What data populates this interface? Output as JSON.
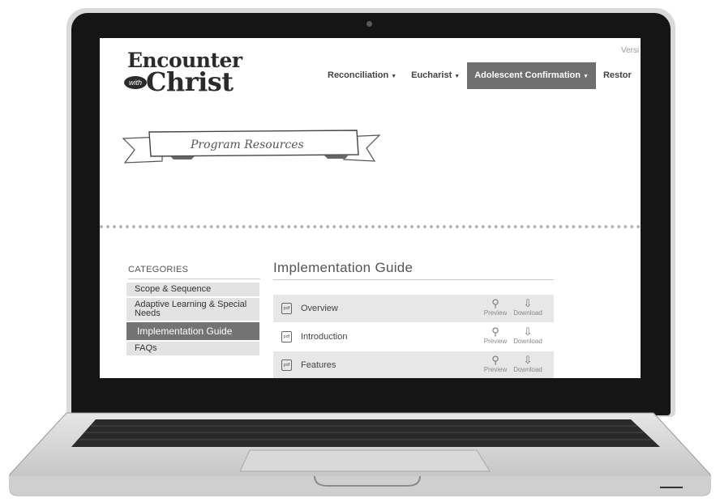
{
  "site": {
    "logo": {
      "line1": "Encounter",
      "with": "with",
      "line2": "Christ"
    },
    "version_text": "Versi"
  },
  "nav": [
    {
      "label": "Reconciliation",
      "active": false
    },
    {
      "label": "Eucharist",
      "active": false
    },
    {
      "label": "Adolescent Confirmation",
      "active": true
    },
    {
      "label": "Restor",
      "active": false
    }
  ],
  "banner": {
    "text": "Program Resources"
  },
  "categories": {
    "title": "CATEGORIES",
    "items": [
      {
        "label": "Scope & Sequence",
        "active": false
      },
      {
        "label": "Adaptive Learning & Special Needs",
        "active": false
      },
      {
        "label": "Implementation Guide",
        "active": true
      },
      {
        "label": "FAQs",
        "active": false
      }
    ]
  },
  "main": {
    "title": "Implementation Guide",
    "file_icon_text": "pdf",
    "preview_label": "Preview",
    "download_label": "Download",
    "preview_icon": "magnifier-icon",
    "download_icon": "arrow-down-icon",
    "resources": [
      {
        "label": "Overview"
      },
      {
        "label": "Introduction"
      },
      {
        "label": "Features"
      }
    ]
  },
  "colors": {
    "active_nav": "#6f6f6f",
    "active_category": "#737373",
    "row_shade": "#e7e7e7"
  }
}
